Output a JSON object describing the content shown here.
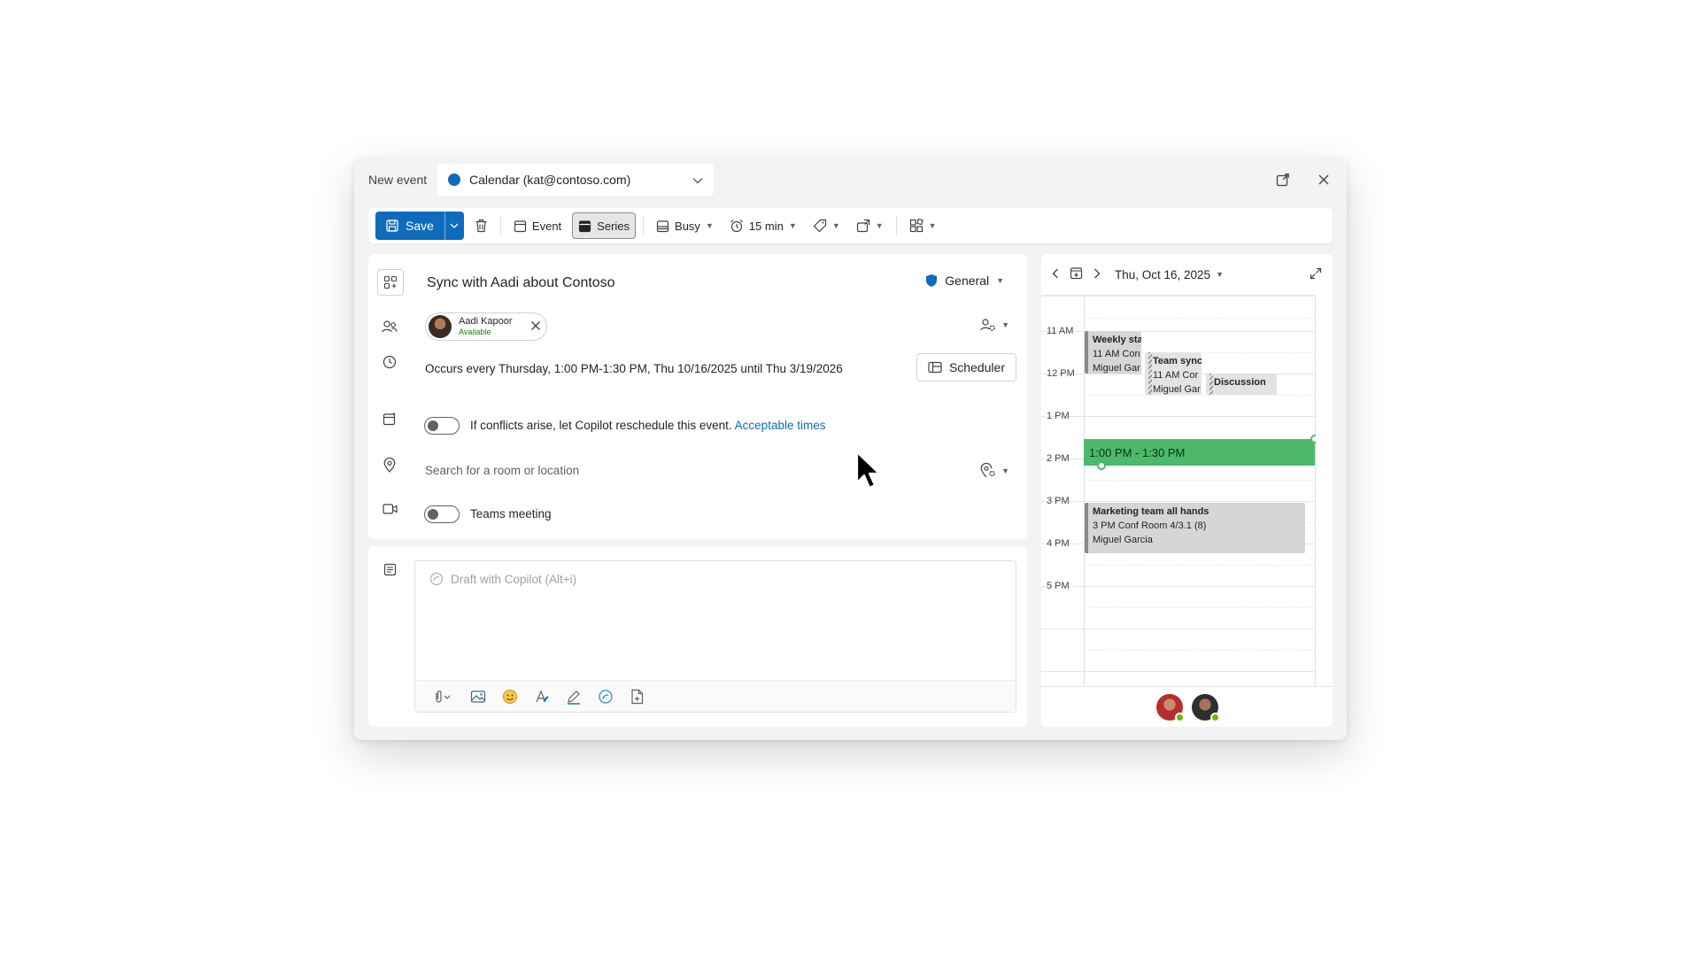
{
  "window": {
    "title": "New event",
    "calendar": "Calendar (kat@contoso.com)",
    "calendar_color": "#0f6cbd"
  },
  "ribbon": {
    "save": "Save",
    "event": "Event",
    "series": "Series",
    "show_as": "Busy",
    "reminder": "15 min"
  },
  "form": {
    "title": "Sync with Aadi about Contoso",
    "sensitivity": "General",
    "attendee": {
      "name": "Aadi Kapoor",
      "status": "Available"
    },
    "recurrence": "Occurs every Thursday, 1:00 PM-1:30 PM, Thu 10/16/2025 until Thu 3/19/2026",
    "scheduler": "Scheduler",
    "copilot_text": "If conflicts arise, let Copilot reschedule this event.",
    "copilot_link": "Acceptable times",
    "location_placeholder": "Search for a room or location",
    "teams_label": "Teams meeting",
    "body_placeholder": "Draft with Copilot (Alt+i)"
  },
  "side": {
    "date": "Thu, Oct 16, 2025",
    "hours": [
      "11 AM",
      "12 PM",
      "1 PM",
      "2 PM",
      "3 PM",
      "4 PM",
      "5 PM"
    ],
    "events": {
      "weekly": {
        "title": "Weekly sta",
        "line2": "11 AM Con",
        "line3": "Miguel Gar"
      },
      "team": {
        "title": "Team sync",
        "line2": "11 AM Cor",
        "line3": "Miguel Gar"
      },
      "discussion": {
        "title": "Discussion"
      },
      "current": {
        "time": "1:00 PM - 1:30 PM"
      },
      "marketing": {
        "title": "Marketing team all hands",
        "line2": "3 PM  Conf Room 4/3.1 (8)",
        "line3": "Miguel Garcia"
      }
    }
  },
  "colors": {
    "accent": "#0f6cbd",
    "current_event": "#4cb96a",
    "presence_available": "#6bb700"
  }
}
